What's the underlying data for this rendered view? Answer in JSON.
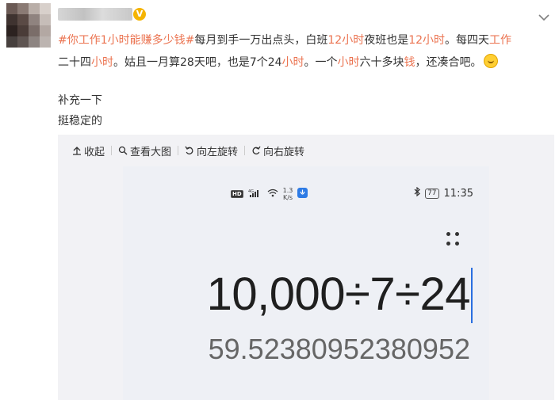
{
  "post": {
    "text": {
      "hashtag": "#你工作1小时能赚多少钱#",
      "s1": "每月到手一万出点头，白班",
      "n12a": "12",
      "hour1": "小时",
      "s2": "夜班也是",
      "n12b": "12",
      "hour2": "小时",
      "s3": "。每四天",
      "work": "工作",
      "s4": "二十四",
      "hour3": "小时",
      "s5": "。姑且一月算28天吧，也是7个24",
      "hour4": "小时",
      "s6": "。一个",
      "hour5": "小时",
      "s7": "六十多块",
      "money": "钱",
      "s8": "，还凑合吧。"
    },
    "extra_line1": "补充一下",
    "extra_line2": "挺稳定的",
    "verified_badge": "V",
    "emoji_icon": "smile-emoji"
  },
  "image_toolbar": {
    "collapse": "收起",
    "view_large": "查看大图",
    "rotate_left": "向左旋转",
    "rotate_right": "向右旋转"
  },
  "phone": {
    "status": {
      "hd": "HD",
      "signal": "⁴ᴳ",
      "speed_value": "1.3",
      "speed_unit": "K/s",
      "battery": "77",
      "time": "11:35"
    },
    "calculator": {
      "expression": "10,000÷7÷24",
      "result": "59.52380952380952"
    }
  },
  "colors": {
    "highlight": "#eb7350",
    "text": "#333333",
    "cursor": "#2a6fe0"
  }
}
